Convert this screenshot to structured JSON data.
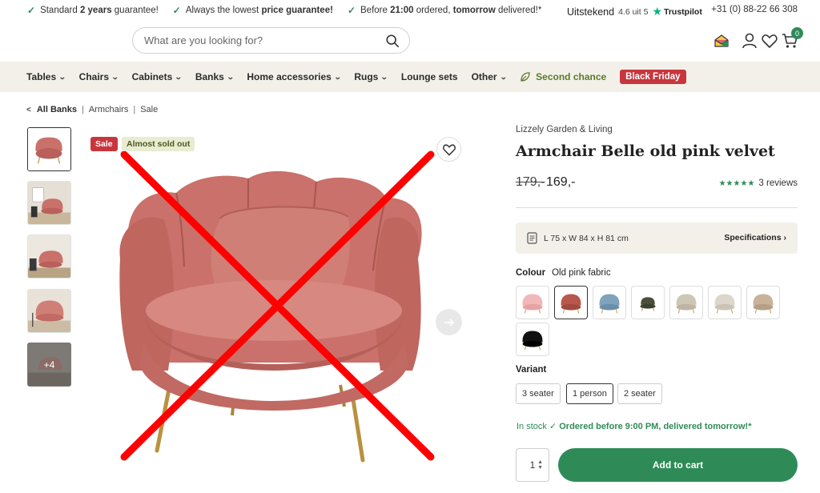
{
  "usp": {
    "u1_pre": "Standard ",
    "u1_bold": "2 years",
    "u1_post": " guarantee!",
    "u2_pre": "Always the lowest ",
    "u2_bold": "price guarantee!",
    "u3_pre": "Before ",
    "u3_bold1": "21:00",
    "u3_mid": " ordered, ",
    "u3_bold2": "tomorrow",
    "u3_post": " delivered!*"
  },
  "trustpilot": {
    "rating_word": "Uitstekend",
    "score": "4.6 uit 5",
    "brand": "Trustpilot"
  },
  "phone": "+31 (0) 88-22 66 308",
  "search": {
    "placeholder": "What are you looking for?"
  },
  "cart": {
    "count": "0"
  },
  "nav": {
    "items": [
      "Tables",
      "Chairs",
      "Cabinets",
      "Banks",
      "Home accessories",
      "Rugs"
    ],
    "lounge": "Lounge sets",
    "other": "Other",
    "second_chance": "Second chance",
    "black_friday": "Black Friday"
  },
  "breadcrumb": {
    "items": [
      "All Banks",
      "Armchairs",
      "Sale"
    ]
  },
  "thumbs": {
    "more_label": "+4"
  },
  "badges": {
    "sale": "Sale",
    "sold_out": "Almost sold out"
  },
  "product": {
    "brand": "Lizzely Garden & Living",
    "title": "Armchair Belle old pink velvet",
    "price_old": "179,-",
    "price_new": "169,-",
    "rating_stars": "★★★★★",
    "reviews": "3 reviews",
    "dimensions": "L 75 x W 84 x H 81 cm",
    "specs_link": "Specifications",
    "colour_label": "Colour",
    "colour_value": "Old pink fabric",
    "variant_label": "Variant",
    "variants": [
      "3 seater",
      "1 person",
      "2 seater"
    ],
    "stock_pre": "In stock",
    "stock_msg": "Ordered before 9:00 PM, delivered tomorrow!*",
    "qty": "1",
    "add_to_cart": "Add to cart"
  },
  "colors": {
    "accent_green": "#2e8b57",
    "sale_red": "#c8363d",
    "nav_bg": "#f3f0ea",
    "velvet_pink": "#c9716a",
    "overlay_cross": "#ff0000"
  },
  "swatch_colors": [
    "#f2b7b8",
    "#b8574c",
    "#7fa3bb",
    "#4a4f3a",
    "#cfc7b6",
    "#ddd7cb",
    "#c8b29a",
    "#111111"
  ]
}
